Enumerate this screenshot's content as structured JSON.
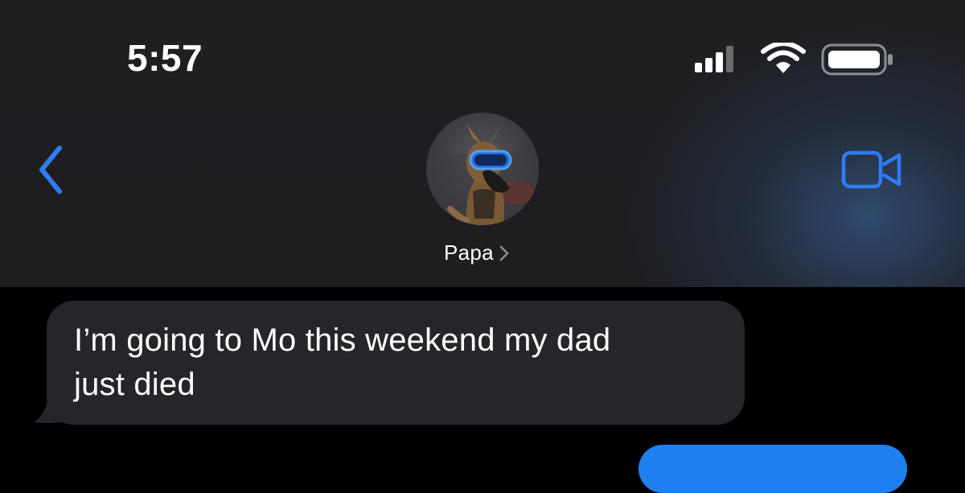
{
  "status_bar": {
    "time": "5:57",
    "signal_icon": "cellular-signal-icon",
    "wifi_icon": "wifi-icon",
    "battery_icon": "battery-icon"
  },
  "nav": {
    "back_icon": "chevron-left-icon",
    "contact_name": "Papa",
    "contact_chevron_icon": "chevron-right-icon",
    "video_icon": "video-camera-icon",
    "avatar_description_icon": "dog-with-goggles-avatar"
  },
  "colors": {
    "accent": "#2f7cf6",
    "header_bg": "#1f1f22",
    "incoming_bubble": "#26252a",
    "outgoing_bubble": "#1e7ff0"
  },
  "messages": [
    {
      "direction": "incoming",
      "lines": [
        "I’m going to Mo this weekend my dad",
        "just died"
      ]
    },
    {
      "direction": "outgoing",
      "lines": []
    }
  ]
}
